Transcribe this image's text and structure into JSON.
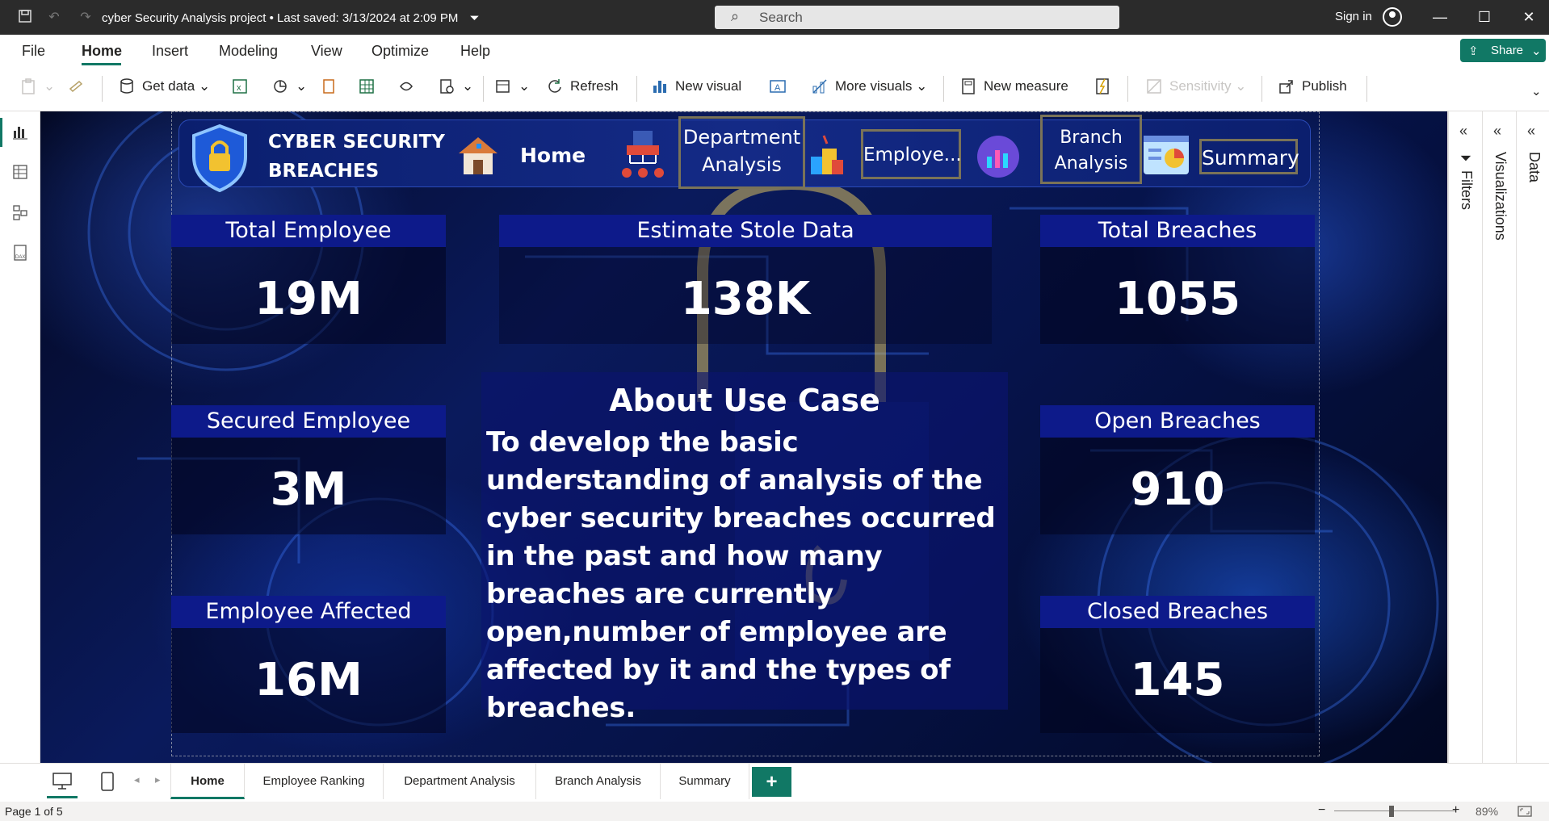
{
  "titlebar": {
    "doc_title": "cyber Security Analysis project",
    "saved": "Last saved: 3/13/2024 at 2:09 PM",
    "search_placeholder": "Search",
    "sign_in": "Sign in"
  },
  "menu": [
    "File",
    "Home",
    "Insert",
    "Modeling",
    "View",
    "Optimize",
    "Help"
  ],
  "share_label": "Share",
  "ribbon": {
    "get_data": "Get data",
    "refresh": "Refresh",
    "new_visual": "New visual",
    "more_visuals": "More visuals",
    "new_measure": "New measure",
    "sensitivity": "Sensitivity",
    "publish": "Publish"
  },
  "report": {
    "nav": {
      "title_line1": "CYBER SECURITY",
      "title_line2": "BREACHES",
      "home": "Home",
      "dept_line1": "Department",
      "dept_line2": "Analysis",
      "employee": "Employe...",
      "branch_line1": "Branch",
      "branch_line2": "Analysis",
      "summary": "Summary"
    },
    "kpis": {
      "total_employee": {
        "label": "Total Employee",
        "value": "19M"
      },
      "estimate_stole": {
        "label": "Estimate Stole Data",
        "value": "138K"
      },
      "total_breaches": {
        "label": "Total Breaches",
        "value": "1055"
      },
      "secured_employee": {
        "label": "Secured Employee",
        "value": "3M"
      },
      "open_breaches": {
        "label": "Open Breaches",
        "value": "910"
      },
      "employee_affected": {
        "label": "Employee Affected",
        "value": "16M"
      },
      "closed_breaches": {
        "label": "Closed Breaches",
        "value": "145"
      }
    },
    "about": {
      "title": "About Use Case",
      "body": "To develop the basic understanding of analysis of the cyber security breaches occurred in the past and how many breaches are currently open,number of employee are affected by it and the types of breaches."
    }
  },
  "panes": {
    "filters": "Filters",
    "visualizations": "Visualizations",
    "data": "Data"
  },
  "tabs": [
    "Home",
    "Employee Ranking",
    "Department Analysis",
    "Branch Analysis",
    "Summary"
  ],
  "add_tab": "+",
  "status": {
    "page": "Page 1 of 5",
    "zoom": "89%"
  },
  "colors": {
    "accent": "#117865",
    "kpi_header": "#0d1a8a",
    "nav_bg": "#142a86"
  }
}
